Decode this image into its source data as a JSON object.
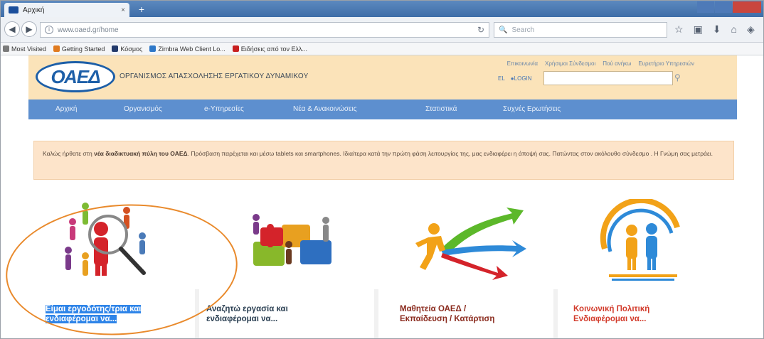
{
  "browser": {
    "tab_title": "Αρχική",
    "tab_close": "×",
    "new_tab": "+",
    "url": "www.oaed.gr/home",
    "search_placeholder": "Search",
    "bookmarks": [
      {
        "label": "Most Visited",
        "color": "#7a7a7a"
      },
      {
        "label": "Getting Started",
        "color": "#e07b20"
      },
      {
        "label": "Κόσμος",
        "color": "#233a6b"
      },
      {
        "label": "Zimbra Web Client Lo...",
        "color": "#2e78c8"
      },
      {
        "label": "Ειδήσεις από τον Ελλ...",
        "color": "#c82020"
      }
    ]
  },
  "site": {
    "logo_text": "ΟΑΕΔ",
    "org_name": "ΟΡΓΑΝΙΣΜΟΣ ΑΠΑΣΧΟΛΗΣΗΣ ΕΡΓΑΤΙΚΟΥ ΔΥΝΑΜΙΚΟΥ",
    "top_links": [
      "Επικοινωνία",
      "Χρήσιμοι Σύνδεσμοι",
      "Πού ανήκω",
      "Ευρετήριο Υπηρεσιών"
    ],
    "lang": "EL",
    "login": "LOGIN",
    "nav": [
      "Αρχική",
      "Οργανισμός",
      "e-Υπηρεσίες",
      "Νέα & Ανακοινώσεις",
      "Στατιστικά",
      "Συχνές Ερωτήσεις"
    ],
    "notice_pre": "Καλώς ήρθατε στη ",
    "notice_bold": "νέα διαδικτυακή πύλη του ΟΑΕΔ",
    "notice_post": ". Πρόσβαση παρέχεται και μέσω tablets και smartphones. Ιδιαίτερα κατά την πρώτη φάση λειτουργίας της, μας ενδιαφέρει η άποψή σας. Πατώντας στον ακόλουθο σύνδεσμο . Η Γνώμη σας μετράει.",
    "cards": [
      {
        "line1": "Είμαι εργοδότης/τρια και",
        "line2": "ενδιαφέρομαι να..."
      },
      {
        "line1": "Αναζητώ εργασία και",
        "line2": "ενδιαφέρομαι να..."
      },
      {
        "line1": "Μαθητεία ΟΑΕΔ /",
        "line2": "Εκπαίδευση / Κατάρτιση"
      },
      {
        "line1": "Κοινωνική Πολιτική",
        "line2": "Ενδιαφέρομαι να..."
      }
    ]
  },
  "colors": {
    "header_bg": "#fbe3b9",
    "nav_bg": "#5d8fcf",
    "notice_bg": "#fde4ca",
    "annotation": "#e98a2c",
    "selection": "#2e84e8"
  }
}
